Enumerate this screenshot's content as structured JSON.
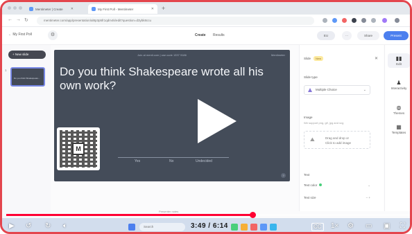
{
  "browser": {
    "tabs": [
      {
        "label": "Mentimeter | Create"
      },
      {
        "label": "My First Poll - Mentimeter"
      }
    ],
    "new_tab": "+",
    "url": "mentimeter.com/app/presentation/al8p3p5fr1qdm4k/edit?question=d3ybk8ccu"
  },
  "app": {
    "back_label": "← My First Poll",
    "tabs": [
      "Create",
      "Results"
    ],
    "active_tab": "Create",
    "share_label": "Share",
    "present_label": "Present",
    "user_badge": "EU"
  },
  "left": {
    "new_slide_label": "+ New slide",
    "slide_number": "1",
    "thumb_text": "Do you think Shakespeare..."
  },
  "slide": {
    "join_info": "Join at menti.com | use code 1337 9186",
    "brand": "Mentimeter",
    "question": "Do you think Shakespeare wrote all his own work?",
    "options": [
      "Yes",
      "No",
      "Undecided"
    ],
    "help_icon": "?"
  },
  "panel": {
    "title": "Slide",
    "badge": "New",
    "slide_type_label": "Slide type",
    "slide_type_value": "Multiple Choice",
    "image_label": "Image",
    "image_hint": "We support png, gif, jpg and svg",
    "drop_line1": "Drag and drop or",
    "drop_line2": "Click to add image",
    "text_label": "Text",
    "text_color_label": "Text color",
    "text_size_label": "Text size"
  },
  "rail": {
    "items": [
      {
        "label": "Edit",
        "icon": "edit-icon"
      },
      {
        "label": "Interactivity",
        "icon": "interactivity-icon"
      },
      {
        "label": "Themes",
        "icon": "themes-icon"
      },
      {
        "label": "Templates",
        "icon": "templates-icon"
      }
    ]
  },
  "player": {
    "current_time": "3:49",
    "total_time": "6:14",
    "time_display": "3:49 / 6:14",
    "progress": 0.61,
    "taskbar_search": "Search",
    "slide_footer": "Presenter notes"
  },
  "colors": {
    "frame_border": "#e3454d",
    "slide_bg": "#1c2535",
    "accent": "#2563eb",
    "progress": "#ff0033"
  }
}
